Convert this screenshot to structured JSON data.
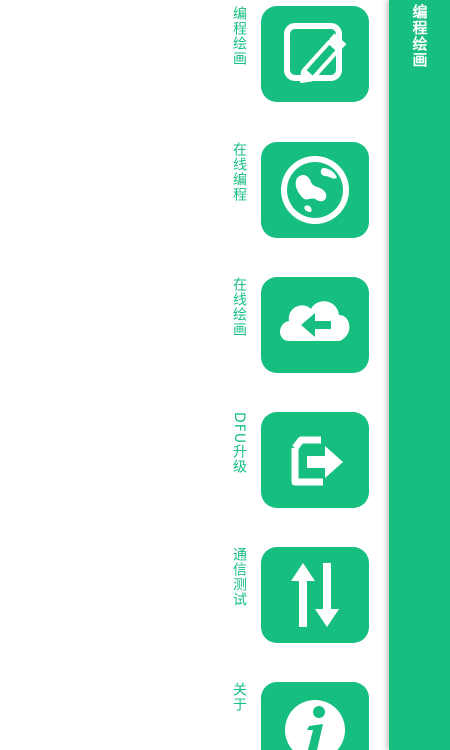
{
  "app_bar": {
    "title": "编程绘画"
  },
  "menu": {
    "items": [
      {
        "label": "编程绘画",
        "icon": "edit-icon"
      },
      {
        "label": "在线编程",
        "icon": "globe-icon"
      },
      {
        "label": "在线绘画",
        "icon": "cloud-upload-icon"
      },
      {
        "label": "DFU升级",
        "icon": "export-icon"
      },
      {
        "label": "通信测试",
        "icon": "swap-arrows-icon"
      },
      {
        "label": "关于",
        "icon": "info-icon"
      }
    ]
  },
  "colors": {
    "accent": "#16bf80",
    "background": "#ffffff",
    "on_accent": "#ffffff"
  }
}
